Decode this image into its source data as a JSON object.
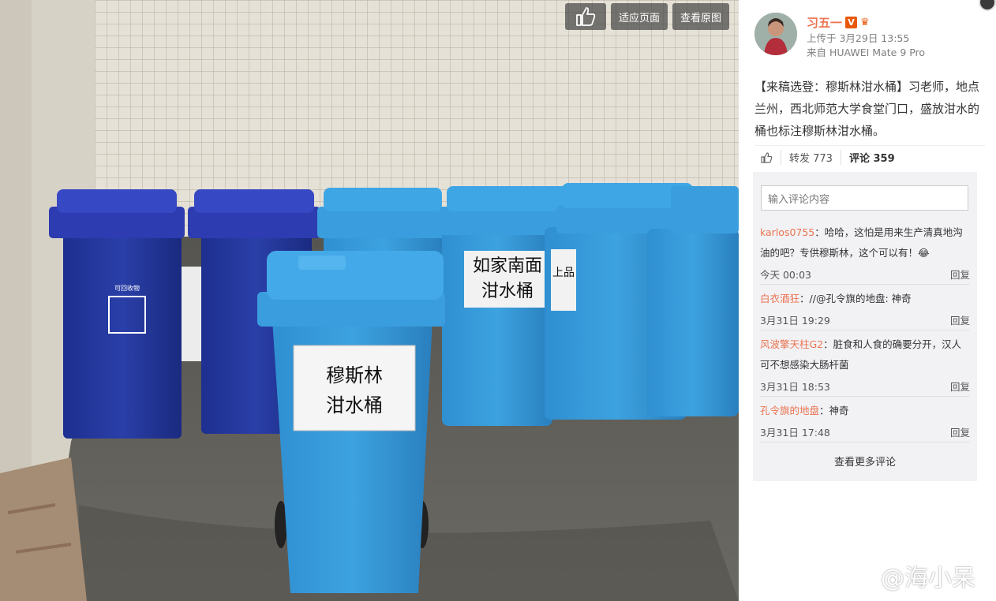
{
  "toolbar": {
    "like_icon": "thumbs-up-icon",
    "fit_label": "适应页面",
    "original_label": "查看原图"
  },
  "photo": {
    "sign_front_line1": "穆斯林",
    "sign_front_line2": "泔水桶",
    "sign_back_line1": "如家南面",
    "sign_back_line2": "泔水桶",
    "sign_side": "上品",
    "bin_label": "可回收物"
  },
  "author": {
    "name": "习五一",
    "verified": "V",
    "upload": "上传于 3月29日 13:55",
    "source": "来自 HUAWEI Mate 9 Pro"
  },
  "post": {
    "text": "【来稿选登：穆斯林泔水桶】习老师，地点兰州，西北师范大学食堂门口，盛放泔水的桶也标注穆斯林泔水桶。"
  },
  "actions": {
    "repost": "转发 773",
    "comment": "评论 359"
  },
  "comments": {
    "placeholder": "输入评论内容",
    "items": [
      {
        "user": "karlos0755",
        "text": "：哈哈，这怕是用来生产清真地沟油的吧？专供穆斯林，这个可以有！😂",
        "time": "今天 00:03",
        "reply": "回复"
      },
      {
        "user": "白衣酒狂",
        "text": "：//@孔令旗的地盘: 神奇",
        "time": "3月31日 19:29",
        "reply": "回复"
      },
      {
        "user": "风波擎天柱G2",
        "text": "：脏食和人食的确要分开，汉人可不想感染大肠杆菌",
        "time": "3月31日 18:53",
        "reply": "回复"
      },
      {
        "user": "孔令旗的地盘",
        "text": "：神奇",
        "time": "3月31日 17:48",
        "reply": "回复"
      }
    ],
    "more": "查看更多评论"
  },
  "watermark": {
    "text": "@海小呆"
  }
}
